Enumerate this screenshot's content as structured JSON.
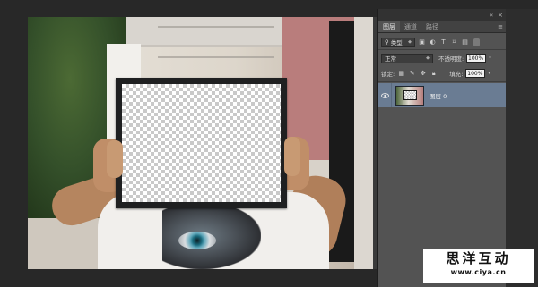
{
  "panel": {
    "topbar_glyphs": [
      "«",
      "×"
    ],
    "tabs": [
      {
        "label": "图层",
        "active": true
      },
      {
        "label": "通道",
        "active": false
      },
      {
        "label": "路径",
        "active": false
      }
    ],
    "tab_menu_icon": "panel-menu-icon",
    "filter": {
      "kind_value": "类型",
      "icons": [
        "image-filter-icon",
        "adjustment-filter-icon",
        "type-filter-icon",
        "shape-filter-icon",
        "smart-object-filter-icon"
      ]
    },
    "blend": {
      "mode_value": "正常",
      "opacity_label": "不透明度:",
      "opacity_value": "100%"
    },
    "lock": {
      "label": "锁定:",
      "icons": [
        "lock-transparent-icon",
        "lock-paint-icon",
        "lock-move-icon",
        "lock-all-icon"
      ],
      "fill_label": "填充:",
      "fill_value": "100%"
    },
    "layers": [
      {
        "name": "图层 0",
        "visible": true,
        "selected": true
      }
    ]
  },
  "watermark": {
    "title": "思洋互动",
    "url": "www.ciya.cn"
  },
  "colors": {
    "panel_bg": "#535353",
    "selected_layer": "#6a7c93",
    "workspace_bg": "#282828"
  }
}
